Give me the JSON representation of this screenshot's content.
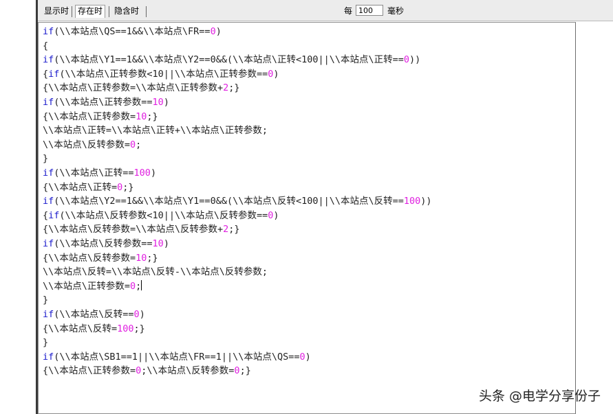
{
  "tabs": [
    {
      "label": "显示时",
      "active": false
    },
    {
      "label": "存在时",
      "active": true
    },
    {
      "label": "隐含时",
      "active": false
    }
  ],
  "interval": {
    "label": "每",
    "value": "100",
    "unit": "毫秒"
  },
  "code_lines": [
    [
      {
        "t": "if",
        "c": "kw"
      },
      {
        "t": "(\\\\本站点\\QS==1&&\\\\本站点\\FR=="
      },
      {
        "t": "0",
        "c": "num"
      },
      {
        "t": ")"
      }
    ],
    [
      {
        "t": "{"
      }
    ],
    [
      {
        "t": "if",
        "c": "kw"
      },
      {
        "t": "(\\\\本站点\\Y1==1&&\\\\本站点\\Y2==0&&(\\\\本站点\\正转<100||\\\\本站点\\正转=="
      },
      {
        "t": "0",
        "c": "num"
      },
      {
        "t": "))"
      }
    ],
    [
      {
        "t": "{"
      },
      {
        "t": "if",
        "c": "kw"
      },
      {
        "t": "(\\\\本站点\\正转参数<10||\\\\本站点\\正转参数=="
      },
      {
        "t": "0",
        "c": "num"
      },
      {
        "t": ")"
      }
    ],
    [
      {
        "t": "{\\\\本站点\\正转参数=\\\\本站点\\正转参数+"
      },
      {
        "t": "2",
        "c": "num"
      },
      {
        "t": ";}"
      }
    ],
    [
      {
        "t": "if",
        "c": "kw"
      },
      {
        "t": "(\\\\本站点\\正转参数=="
      },
      {
        "t": "10",
        "c": "num"
      },
      {
        "t": ")"
      }
    ],
    [
      {
        "t": "{\\\\本站点\\正转参数="
      },
      {
        "t": "10",
        "c": "num"
      },
      {
        "t": ";}"
      }
    ],
    [
      {
        "t": "\\\\本站点\\正转=\\\\本站点\\正转+\\\\本站点\\正转参数;"
      }
    ],
    [
      {
        "t": "\\\\本站点\\反转参数="
      },
      {
        "t": "0",
        "c": "num"
      },
      {
        "t": ";"
      }
    ],
    [
      {
        "t": "}"
      }
    ],
    [
      {
        "t": "if",
        "c": "kw"
      },
      {
        "t": "(\\\\本站点\\正转=="
      },
      {
        "t": "100",
        "c": "num"
      },
      {
        "t": ")"
      }
    ],
    [
      {
        "t": "{\\\\本站点\\正转="
      },
      {
        "t": "0",
        "c": "num"
      },
      {
        "t": ";}"
      }
    ],
    [
      {
        "t": "if",
        "c": "kw"
      },
      {
        "t": "(\\\\本站点\\Y2==1&&\\\\本站点\\Y1==0&&(\\\\本站点\\反转<100||\\\\本站点\\反转=="
      },
      {
        "t": "100",
        "c": "num"
      },
      {
        "t": "))"
      }
    ],
    [
      {
        "t": "{"
      },
      {
        "t": "if",
        "c": "kw"
      },
      {
        "t": "(\\\\本站点\\反转参数<10||\\\\本站点\\反转参数=="
      },
      {
        "t": "0",
        "c": "num"
      },
      {
        "t": ")"
      }
    ],
    [
      {
        "t": "{\\\\本站点\\反转参数=\\\\本站点\\反转参数+"
      },
      {
        "t": "2",
        "c": "num"
      },
      {
        "t": ";}"
      }
    ],
    [
      {
        "t": "if",
        "c": "kw"
      },
      {
        "t": "(\\\\本站点\\反转参数=="
      },
      {
        "t": "10",
        "c": "num"
      },
      {
        "t": ")"
      }
    ],
    [
      {
        "t": "{\\\\本站点\\反转参数="
      },
      {
        "t": "10",
        "c": "num"
      },
      {
        "t": ";}"
      }
    ],
    [
      {
        "t": "\\\\本站点\\反转=\\\\本站点\\反转-\\\\本站点\\反转参数;"
      }
    ],
    [
      {
        "t": "\\\\本站点\\正转参数="
      },
      {
        "t": "0",
        "c": "num"
      },
      {
        "t": ";"
      },
      {
        "t": "",
        "c": "cursor"
      }
    ],
    [
      {
        "t": "}"
      }
    ],
    [
      {
        "t": "if",
        "c": "kw"
      },
      {
        "t": "(\\\\本站点\\反转=="
      },
      {
        "t": "0",
        "c": "num"
      },
      {
        "t": ")"
      }
    ],
    [
      {
        "t": "{\\\\本站点\\反转="
      },
      {
        "t": "100",
        "c": "num"
      },
      {
        "t": ";}"
      }
    ],
    [
      {
        "t": "}"
      }
    ],
    [
      {
        "t": "if",
        "c": "kw"
      },
      {
        "t": "(\\\\本站点\\SB1==1||\\\\本站点\\FR==1||\\\\本站点\\QS=="
      },
      {
        "t": "0",
        "c": "num"
      },
      {
        "t": ")"
      }
    ],
    [
      {
        "t": "{\\\\本站点\\正转参数="
      },
      {
        "t": "0",
        "c": "num"
      },
      {
        "t": ";\\\\本站点\\反转参数="
      },
      {
        "t": "0",
        "c": "num"
      },
      {
        "t": ";}"
      }
    ]
  ],
  "watermark": "头条 @电学分享份子"
}
